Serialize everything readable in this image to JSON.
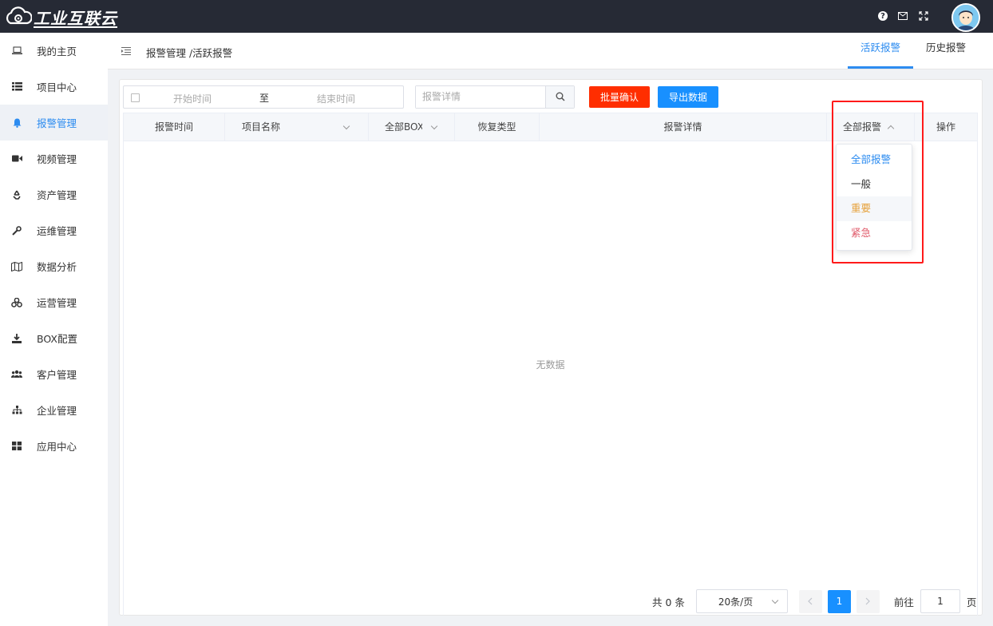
{
  "brand": {
    "name": "工业互联云"
  },
  "sidebar": {
    "items": [
      {
        "label": "我的主页",
        "icon": "laptop-icon"
      },
      {
        "label": "项目中心",
        "icon": "list-icon"
      },
      {
        "label": "报警管理",
        "icon": "bell-icon",
        "active": true
      },
      {
        "label": "视频管理",
        "icon": "video-camera-icon"
      },
      {
        "label": "资产管理",
        "icon": "recycle-icon"
      },
      {
        "label": "运维管理",
        "icon": "wrench-icon"
      },
      {
        "label": "数据分析",
        "icon": "map-icon"
      },
      {
        "label": "运营管理",
        "icon": "cubes-icon"
      },
      {
        "label": "BOX配置",
        "icon": "download-icon"
      },
      {
        "label": "客户管理",
        "icon": "users-icon"
      },
      {
        "label": "企业管理",
        "icon": "sitemap-icon"
      },
      {
        "label": "应用中心",
        "icon": "grid-icon"
      }
    ]
  },
  "header": {
    "breadcrumb": "报警管理 /活跃报警",
    "tabs": [
      {
        "label": "活跃报警",
        "active": true
      },
      {
        "label": "历史报警"
      }
    ]
  },
  "toolbar": {
    "start_placeholder": "开始时间",
    "range_separator": "至",
    "end_placeholder": "结束时间",
    "search_placeholder": "报警详情",
    "confirm_label": "批量确认",
    "export_label": "导出数据"
  },
  "table": {
    "columns": [
      "报警时间",
      "项目名称",
      "全部BOX",
      "恢复类型",
      "报警详情",
      "全部报警",
      "操作"
    ],
    "empty_text": "无数据"
  },
  "dropdown": {
    "items": [
      {
        "label": "全部报警",
        "color": "#2d8cf0"
      },
      {
        "label": "一般",
        "color": "#333333"
      },
      {
        "label": "重要",
        "color": "#e6a23c"
      },
      {
        "label": "紧急",
        "color": "#e05a6a"
      }
    ]
  },
  "pagination": {
    "total": "共 0 条",
    "page_size": "20条/页",
    "current_page": "1",
    "goto_label": "前往",
    "goto_value": "1",
    "page_unit": "页"
  },
  "colors": {
    "accent": "#2d8cf0",
    "danger_button": "#ff2e00",
    "primary_button": "#1890ff",
    "topbar": "#262a35"
  }
}
